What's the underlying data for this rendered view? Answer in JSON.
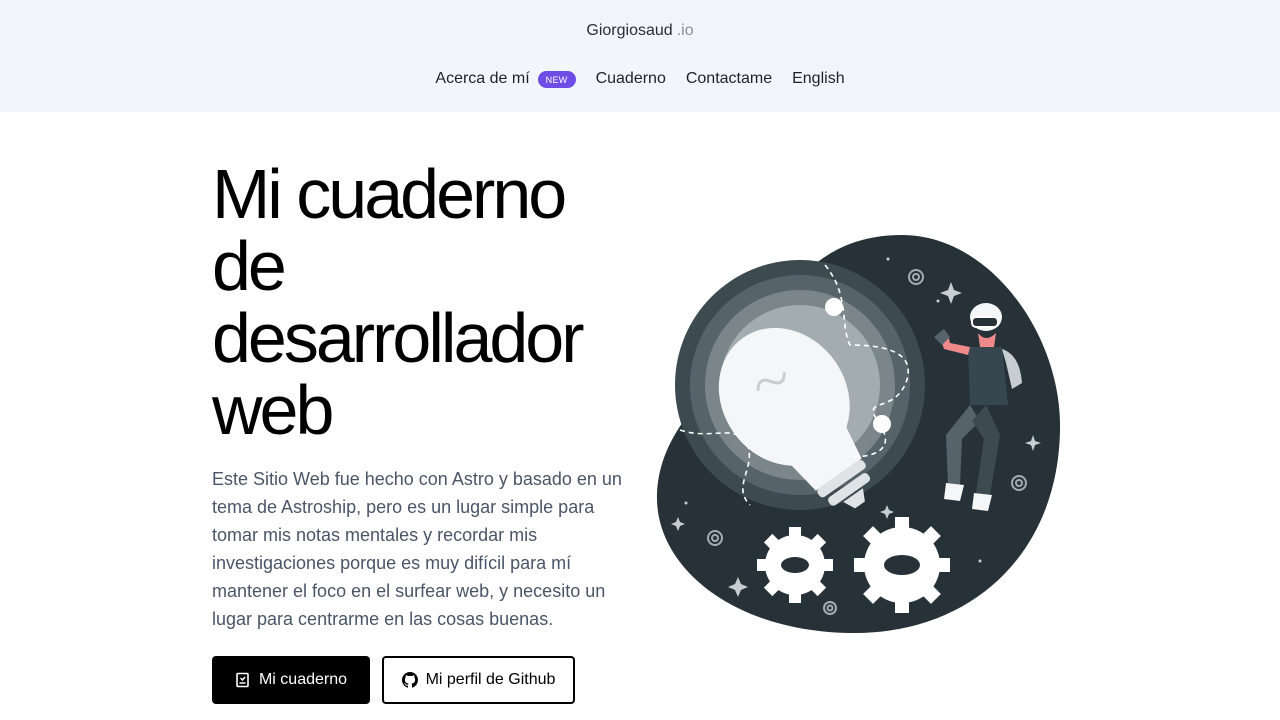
{
  "header": {
    "brand_name": "Giorgiosaud",
    "brand_tld": ".io",
    "nav": [
      {
        "label": "Acerca de mí",
        "badge": "NEW"
      },
      {
        "label": "Cuaderno"
      },
      {
        "label": "Contactame"
      },
      {
        "label": "English"
      }
    ]
  },
  "hero": {
    "title_lines": [
      "Mi cuaderno",
      "de",
      "desarrollador",
      "web"
    ],
    "description": "Este Sitio Web fue hecho con Astro y basado en un tema de Astroship, pero es un lugar simple para tomar mis notas mentales y recordar mis investigaciones porque es muy difícil para mí mantener el foco en el surfear web, y necesito un lugar para centrarme en las cosas buenas.",
    "primary_button": {
      "label": "Mi cuaderno",
      "icon": "notebook-icon"
    },
    "secondary_button": {
      "label": "Mi perfil de Github",
      "icon": "github-icon"
    }
  },
  "colors": {
    "header_bg": "#f2f5fa",
    "badge": "#6d4de6",
    "illustration_dark": "#263238"
  }
}
